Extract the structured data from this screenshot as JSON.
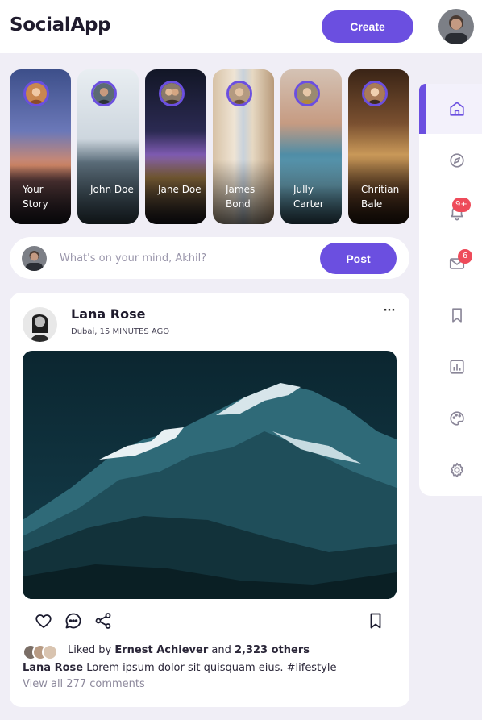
{
  "header": {
    "logo": "SocialApp",
    "create_label": "Create"
  },
  "stories": [
    {
      "name": "Your Story"
    },
    {
      "name": "John Doe"
    },
    {
      "name": "Jane Doe"
    },
    {
      "name": "James Bond"
    },
    {
      "name": "Jully Carter"
    },
    {
      "name": "Chritian Bale"
    }
  ],
  "composer": {
    "placeholder": "What's on your mind, Akhil?",
    "post_label": "Post"
  },
  "post": {
    "author": "Lana Rose",
    "meta": "Dubai, 15 MINUTES AGO",
    "more_label": "···",
    "liked_prefix": "Liked by",
    "liked_user": "Ernest Achiever",
    "liked_and": "and",
    "liked_others": "2,323 others",
    "caption_author": "Lana Rose",
    "caption_text": "Lorem ipsum dolor sit quisquam eius. #lifestyle",
    "view_comments": "View all 277 comments"
  },
  "sidebar": {
    "items": [
      {
        "icon": "home-icon",
        "active": true
      },
      {
        "icon": "compass-icon"
      },
      {
        "icon": "bell-icon",
        "badge": "9+"
      },
      {
        "icon": "mail-icon",
        "badge": "6"
      },
      {
        "icon": "bookmark-icon"
      },
      {
        "icon": "analytics-icon"
      },
      {
        "icon": "palette-icon"
      },
      {
        "icon": "settings-icon"
      }
    ]
  },
  "colors": {
    "accent": "#6b4fe0",
    "badge": "#ee4b5a",
    "background": "#f0eef6"
  }
}
